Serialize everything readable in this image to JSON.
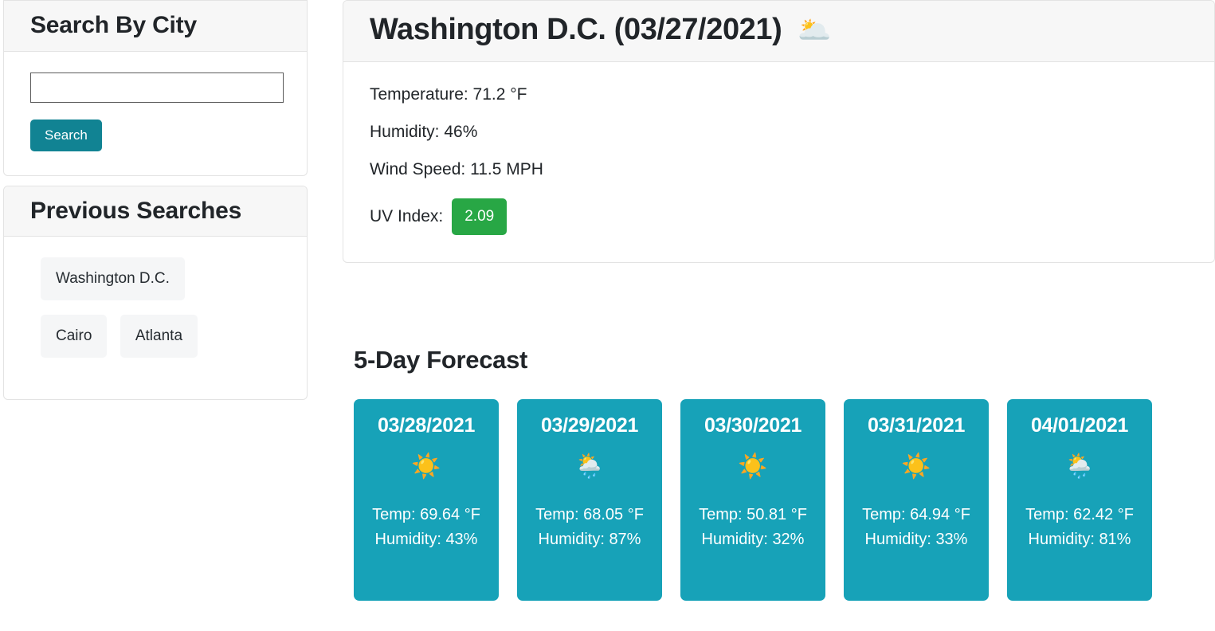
{
  "sidebar": {
    "search_panel": {
      "heading": "Search By City",
      "input_value": "",
      "input_placeholder": "",
      "button_label": "Search"
    },
    "previous_panel": {
      "heading": "Previous Searches",
      "items": [
        {
          "label": "Washington D.C."
        },
        {
          "label": "Cairo"
        },
        {
          "label": "Atlanta"
        }
      ]
    }
  },
  "main": {
    "current": {
      "city": "Washington D.C.",
      "date": "(03/27/2021)",
      "title": "Washington D.C. (03/27/2021)",
      "condition_icon": "🌥️",
      "condition_icon_name": "broken-clouds-icon",
      "temperature": "Temperature: 71.2 °F",
      "humidity": "Humidity: 46%",
      "wind_speed": "Wind Speed: 11.5 MPH",
      "uv_label": "UV Index:",
      "uv_value": "2.09"
    },
    "forecast": {
      "heading": "5-Day Forecast",
      "days": [
        {
          "date": "03/28/2021",
          "icon": "☀️",
          "icon_name": "sun-icon",
          "temp": "Temp: 69.64 °F",
          "humidity": "Humidity: 43%"
        },
        {
          "date": "03/29/2021",
          "icon": "🌦️",
          "icon_name": "sun-behind-rain-cloud-icon",
          "temp": "Temp: 68.05 °F",
          "humidity": "Humidity: 87%"
        },
        {
          "date": "03/30/2021",
          "icon": "☀️",
          "icon_name": "sun-icon",
          "temp": "Temp: 50.81 °F",
          "humidity": "Humidity: 32%"
        },
        {
          "date": "03/31/2021",
          "icon": "☀️",
          "icon_name": "sun-icon",
          "temp": "Temp: 64.94 °F",
          "humidity": "Humidity: 33%"
        },
        {
          "date": "04/01/2021",
          "icon": "🌦️",
          "icon_name": "sun-behind-rain-cloud-icon",
          "temp": "Temp: 62.42 °F",
          "humidity": "Humidity: 81%"
        }
      ]
    }
  },
  "colors": {
    "teal_card": "#17a2b8",
    "teal_button": "#118393",
    "uv_green": "#28a745",
    "panel_header": "#f7f7f7",
    "chip_bg": "#f5f6f7",
    "border": "#e3e3e3"
  }
}
